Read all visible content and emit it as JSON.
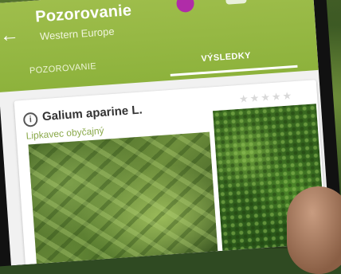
{
  "header": {
    "title": "Pozorovanie",
    "subtitle": "Western Europe"
  },
  "tabs": [
    {
      "label": "POZOROVANIE"
    },
    {
      "label": "VÝSLEDKY"
    }
  ],
  "result": {
    "scientific_name": "Galium aparine L.",
    "common_name": "Lipkavec obyčajný",
    "rating_stars": "★★★★★",
    "info_icon": "i"
  },
  "colors": {
    "appbar": "#8db23c",
    "accent_text": "#8aa94a"
  },
  "icons": {
    "back": "arrow-left-icon",
    "info": "info-icon",
    "rating": "star-icon"
  }
}
